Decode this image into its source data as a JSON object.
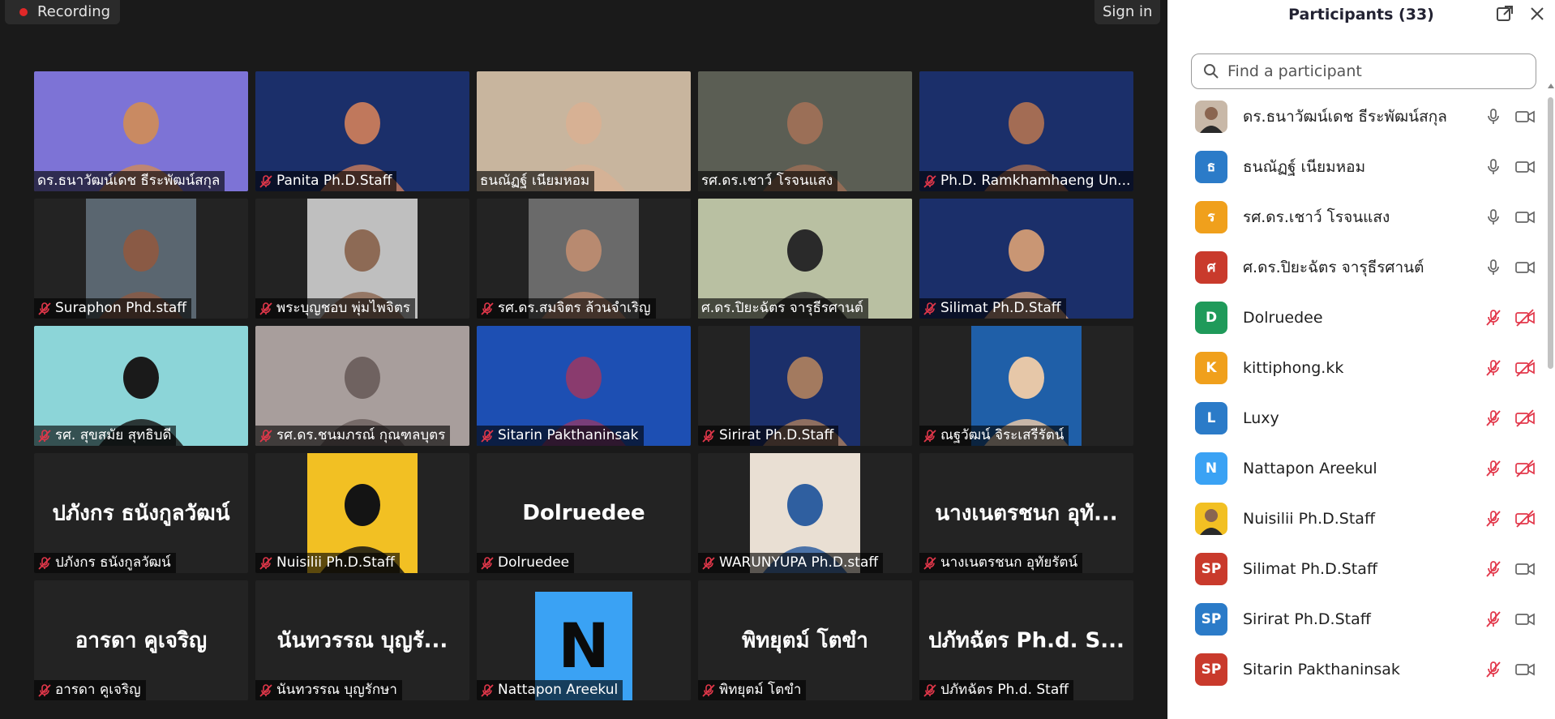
{
  "toolbar": {
    "recording_label": "Recording",
    "signin_label": "Sign in"
  },
  "tiles": [
    {
      "label": "ดร.ธนาวัฒน์เดช  ธีระพัฒน์สกุล",
      "muted": false,
      "bg": "#7d73d6",
      "person": "#c98a62",
      "active": false,
      "mode": "video"
    },
    {
      "label": "Panita Ph.D.Staff",
      "muted": true,
      "bg": "#1b2f6a",
      "person": "#c0785c",
      "active": false,
      "mode": "video"
    },
    {
      "label": "ธนณัฏฐ์ เนียมหอม",
      "muted": false,
      "bg": "#c8b59e",
      "person": "#d7b194",
      "active": false,
      "mode": "video"
    },
    {
      "label": "รศ.ดร.เชาว์  โรจนแสง",
      "muted": false,
      "bg": "#5b5e54",
      "person": "#9b6f57",
      "active": false,
      "mode": "video"
    },
    {
      "label": "Ph.D. Ramkhamhaeng Un...",
      "muted": true,
      "bg": "#1b2f6a",
      "person": "#a36c54",
      "active": false,
      "mode": "video"
    },
    {
      "label": "Suraphon Phd.staff",
      "muted": true,
      "bg": "#5a6670",
      "person": "#8a5a45",
      "active": false,
      "mode": "inset-video"
    },
    {
      "label": "พระบุญชอบ พุ่มไพจิตร",
      "muted": true,
      "bg": "#bfbfbf",
      "person": "#8d6a55",
      "active": false,
      "mode": "inset-video"
    },
    {
      "label": "รศ.ดร.สมจิตร ล้วนจำเริญ",
      "muted": true,
      "bg": "#6a6a6a",
      "person": "#b88a70",
      "active": false,
      "mode": "inset-video"
    },
    {
      "label": "ศ.ดร.ปิยะฉัตร จารุธีรศานต์",
      "muted": false,
      "bg": "#b9c0a2",
      "person": "#2a2a2a",
      "active": true,
      "mode": "video"
    },
    {
      "label": "Silimat Ph.D.Staff",
      "muted": true,
      "bg": "#1b2f6a",
      "person": "#c99674",
      "active": false,
      "mode": "video"
    },
    {
      "label": "รศ. สุขสมัย สุทธิบดี",
      "muted": true,
      "bg": "#8cd5d8",
      "person": "#1a1a1a",
      "active": false,
      "mode": "video"
    },
    {
      "label": "รศ.ดร.ชนมภรณ์  กุณฑลบุตร",
      "muted": true,
      "bg": "#a89e9c",
      "person": "#6f6260",
      "active": false,
      "mode": "video"
    },
    {
      "label": "Sitarin Pakthaninsak",
      "muted": true,
      "bg": "#1d4fb3",
      "person": "#8a3b6e",
      "active": false,
      "mode": "video"
    },
    {
      "label": "Sirirat Ph.D.Staff",
      "muted": true,
      "bg": "#1b2f6a",
      "person": "#a37a5f",
      "active": false,
      "mode": "inset-video"
    },
    {
      "label": "ณฐวัฒน์ จิระเสรีรัตน์",
      "muted": true,
      "bg": "#1f5fa8",
      "person": "#e6c7a8",
      "active": false,
      "mode": "inset-video"
    },
    {
      "label": "ปภังกร ธนังกูลวัฒน์",
      "muted": true,
      "big": "ปภังกร ธนังกูลวัฒน์",
      "active": false,
      "mode": "name"
    },
    {
      "label": "Nuisilii Ph.D.Staff",
      "muted": true,
      "bg": "#f2c023",
      "person": "#141414",
      "active": false,
      "mode": "inset-video"
    },
    {
      "label": "Dolruedee",
      "muted": true,
      "big": "Dolruedee",
      "active": false,
      "mode": "name"
    },
    {
      "label": "WARUNYUPA Ph.D.staff",
      "muted": true,
      "bg": "#e9dfd3",
      "person": "#2f5fa0",
      "active": false,
      "mode": "inset-video"
    },
    {
      "label": "นางเนตรชนก อุทัยรัตน์",
      "muted": true,
      "big": "นางเนตรชนก อุทั...",
      "active": false,
      "mode": "name"
    },
    {
      "label": "อารดา คูเจริญ",
      "muted": true,
      "big": "อารดา คูเจริญ",
      "active": false,
      "mode": "name"
    },
    {
      "label": "นันทวรรณ บุญรักษา",
      "muted": true,
      "big": "นันทวรรณ บุญรั...",
      "active": false,
      "mode": "name"
    },
    {
      "label": "Nattapon Areekul",
      "muted": true,
      "avatar_letter": "N",
      "active": false,
      "mode": "avatar"
    },
    {
      "label": "พิทยุตม์  โตขำ",
      "muted": true,
      "big": "พิทยุตม์  โตขำ",
      "active": false,
      "mode": "name"
    },
    {
      "label": "ปภัทฉัตร Ph.d. Staff",
      "muted": true,
      "big": "ปภัทฉัตร Ph.d. S...",
      "active": false,
      "mode": "name"
    }
  ],
  "panel": {
    "title": "Participants (33)",
    "search_placeholder": "Find a participant",
    "participants": [
      {
        "name": "ดร.ธนาวัฒน์เดช  ธีระพัฒน์สกุล",
        "initials": "",
        "color": "#c8b8a8",
        "mic": "on",
        "cam": "on"
      },
      {
        "name": "ธนณัฏฐ์ เนียมหอม",
        "initials": "ธ",
        "color": "#2b7bc8",
        "mic": "on",
        "cam": "on"
      },
      {
        "name": "รศ.ดร.เชาว์ โรจนแสง",
        "initials": "ร",
        "color": "#f0a01c",
        "mic": "on",
        "cam": "on"
      },
      {
        "name": "ศ.ดร.ปิยะฉัตร จารุธีรศานต์",
        "initials": "ศ",
        "color": "#c93a2c",
        "mic": "on",
        "cam": "on"
      },
      {
        "name": "Dolruedee",
        "initials": "D",
        "color": "#1f9a5a",
        "mic": "off",
        "cam": "off"
      },
      {
        "name": "kittiphong.kk",
        "initials": "K",
        "color": "#f0a01c",
        "mic": "off",
        "cam": "off"
      },
      {
        "name": "Luxy",
        "initials": "L",
        "color": "#2b7bc8",
        "mic": "off",
        "cam": "off"
      },
      {
        "name": "Nattapon Areekul",
        "initials": "N",
        "color": "#3aa2f4",
        "mic": "off",
        "cam": "off"
      },
      {
        "name": "Nuisilii Ph.D.Staff",
        "initials": "",
        "color": "#f2c023",
        "mic": "off",
        "cam": "off"
      },
      {
        "name": "Silimat Ph.D.Staff",
        "initials": "SP",
        "color": "#c93a2c",
        "mic": "off",
        "cam": "on"
      },
      {
        "name": "Sirirat Ph.D.Staff",
        "initials": "SP",
        "color": "#2b7bc8",
        "mic": "off",
        "cam": "on"
      },
      {
        "name": "Sitarin Pakthaninsak",
        "initials": "SP",
        "color": "#c93a2c",
        "mic": "off",
        "cam": "on"
      }
    ]
  }
}
